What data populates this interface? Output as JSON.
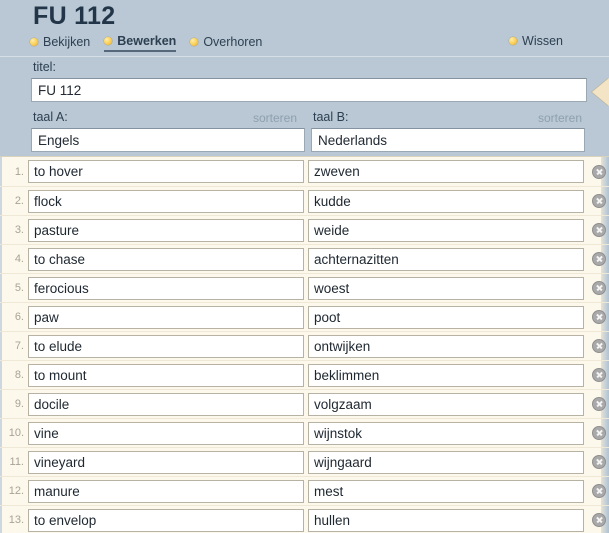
{
  "header": {
    "title": "FU 112"
  },
  "nav": {
    "bullet_color": "#fcd462",
    "left_items": [
      {
        "label": "Bekijken",
        "active": false
      },
      {
        "label": "Bewerken",
        "active": true
      },
      {
        "label": "Overhoren",
        "active": false
      }
    ],
    "right_items": [
      {
        "label": "Wissen",
        "active": false
      }
    ]
  },
  "form": {
    "title_label": "titel:",
    "title_value": "FU 112",
    "lang_a_label": "taal A:",
    "lang_a_value": "Engels",
    "lang_b_label": "taal B:",
    "lang_b_value": "Nederlands",
    "sort_a_label": "sorteren",
    "sort_b_label": "sorteren"
  },
  "list": {
    "delete_icon": "circle-x-icon",
    "rows": [
      {
        "num": "1.",
        "a": "to hover",
        "b": "zweven"
      },
      {
        "num": "2.",
        "a": "flock",
        "b": "kudde"
      },
      {
        "num": "3.",
        "a": "pasture",
        "b": "weide"
      },
      {
        "num": "4.",
        "a": "to chase",
        "b": "achternazitten"
      },
      {
        "num": "5.",
        "a": "ferocious",
        "b": "woest"
      },
      {
        "num": "6.",
        "a": "paw",
        "b": "poot"
      },
      {
        "num": "7.",
        "a": "to elude",
        "b": "ontwijken"
      },
      {
        "num": "8.",
        "a": "to mount",
        "b": "beklimmen"
      },
      {
        "num": "9.",
        "a": "docile",
        "b": "volgzaam"
      },
      {
        "num": "10.",
        "a": "vine",
        "b": "wijnstok"
      },
      {
        "num": "11.",
        "a": "vineyard",
        "b": "wijngaard"
      },
      {
        "num": "12.",
        "a": "manure",
        "b": "mest"
      },
      {
        "num": "13.",
        "a": "to envelop",
        "b": "hullen"
      }
    ]
  },
  "colors": {
    "page_background": "#b9c8d4",
    "list_background": "#fcf8ec",
    "title_text": "#233649",
    "accent_bullet": "#fcd462",
    "edge_arrow": "#f2e4c4"
  }
}
